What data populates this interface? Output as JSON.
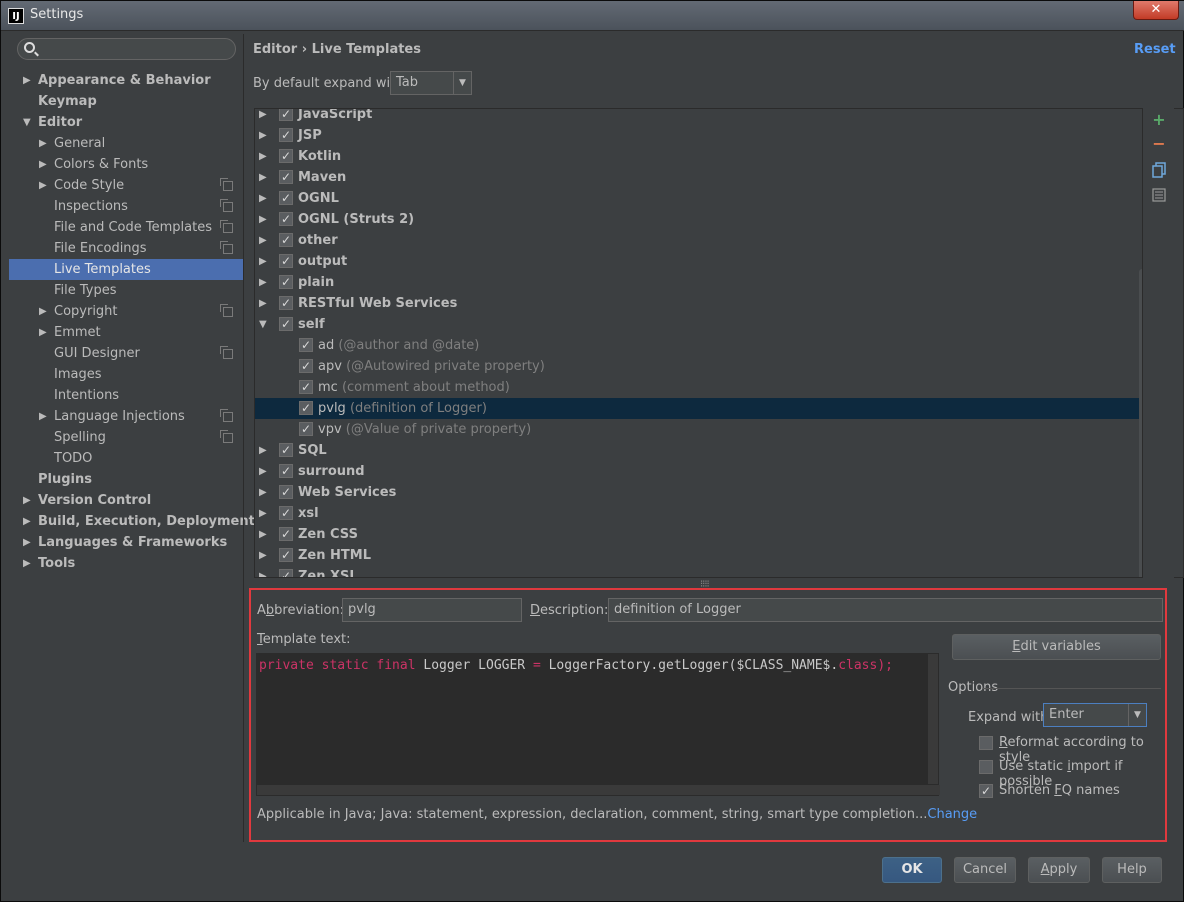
{
  "window": {
    "title": "Settings",
    "app_icon": "IJ",
    "close": "✕"
  },
  "search": {
    "value": ""
  },
  "tree": [
    {
      "label": "Appearance & Behavior",
      "level": 0,
      "bold": true,
      "arrow": "▶"
    },
    {
      "label": "Keymap",
      "level": 0,
      "bold": true,
      "arrow": ""
    },
    {
      "label": "Editor",
      "level": 0,
      "bold": true,
      "arrow": "▼"
    },
    {
      "label": "General",
      "level": 1,
      "arrow": "▶"
    },
    {
      "label": "Colors & Fonts",
      "level": 1,
      "arrow": "▶"
    },
    {
      "label": "Code Style",
      "level": 1,
      "arrow": "▶",
      "copy": true
    },
    {
      "label": "Inspections",
      "level": 1,
      "arrow": "",
      "copy": true
    },
    {
      "label": "File and Code Templates",
      "level": 1,
      "arrow": "",
      "copy": true
    },
    {
      "label": "File Encodings",
      "level": 1,
      "arrow": "",
      "copy": true
    },
    {
      "label": "Live Templates",
      "level": 1,
      "arrow": "",
      "selected": true
    },
    {
      "label": "File Types",
      "level": 1,
      "arrow": ""
    },
    {
      "label": "Copyright",
      "level": 1,
      "arrow": "▶",
      "copy": true
    },
    {
      "label": "Emmet",
      "level": 1,
      "arrow": "▶"
    },
    {
      "label": "GUI Designer",
      "level": 1,
      "arrow": "",
      "copy": true
    },
    {
      "label": "Images",
      "level": 1,
      "arrow": ""
    },
    {
      "label": "Intentions",
      "level": 1,
      "arrow": ""
    },
    {
      "label": "Language Injections",
      "level": 1,
      "arrow": "▶",
      "copy": true
    },
    {
      "label": "Spelling",
      "level": 1,
      "arrow": "",
      "copy": true
    },
    {
      "label": "TODO",
      "level": 1,
      "arrow": ""
    },
    {
      "label": "Plugins",
      "level": 0,
      "bold": true,
      "arrow": ""
    },
    {
      "label": "Version Control",
      "level": 0,
      "bold": true,
      "arrow": "▶"
    },
    {
      "label": "Build, Execution, Deployment",
      "level": 0,
      "bold": true,
      "arrow": "▶"
    },
    {
      "label": "Languages & Frameworks",
      "level": 0,
      "bold": true,
      "arrow": "▶"
    },
    {
      "label": "Tools",
      "level": 0,
      "bold": true,
      "arrow": "▶"
    }
  ],
  "header": {
    "crumb_parent": "Editor",
    "crumb_sep": "›",
    "crumb_current": "Live Templates",
    "reset": "Reset"
  },
  "expand_default": {
    "label": "By default expand with",
    "value": "Tab"
  },
  "groups": [
    {
      "type": "group",
      "name": "JavaScript",
      "expanded": false
    },
    {
      "type": "group",
      "name": "JSP",
      "expanded": false
    },
    {
      "type": "group",
      "name": "Kotlin",
      "expanded": false
    },
    {
      "type": "group",
      "name": "Maven",
      "expanded": false
    },
    {
      "type": "group",
      "name": "OGNL",
      "expanded": false
    },
    {
      "type": "group",
      "name": "OGNL (Struts 2)",
      "expanded": false
    },
    {
      "type": "group",
      "name": "other",
      "expanded": false
    },
    {
      "type": "group",
      "name": "output",
      "expanded": false
    },
    {
      "type": "group",
      "name": "plain",
      "expanded": false
    },
    {
      "type": "group",
      "name": "RESTful Web Services",
      "expanded": false
    },
    {
      "type": "group",
      "name": "self",
      "expanded": true
    },
    {
      "type": "item",
      "name": "ad",
      "desc": "(@author and @date)"
    },
    {
      "type": "item",
      "name": "apv",
      "desc": "(@Autowired private property)"
    },
    {
      "type": "item",
      "name": "mc",
      "desc": "(comment about method)"
    },
    {
      "type": "item",
      "name": "pvlg",
      "desc": "(definition of Logger)",
      "selected": true
    },
    {
      "type": "item",
      "name": "vpv",
      "desc": "(@Value of private property)"
    },
    {
      "type": "group",
      "name": "SQL",
      "expanded": false
    },
    {
      "type": "group",
      "name": "surround",
      "expanded": false
    },
    {
      "type": "group",
      "name": "Web Services",
      "expanded": false
    },
    {
      "type": "group",
      "name": "xsl",
      "expanded": false
    },
    {
      "type": "group",
      "name": "Zen CSS",
      "expanded": false
    },
    {
      "type": "group",
      "name": "Zen HTML",
      "expanded": false
    },
    {
      "type": "group",
      "name": "Zen XSL",
      "expanded": false
    }
  ],
  "tools": {
    "add": "+",
    "remove": "−"
  },
  "detail": {
    "abbr_label_pre": "A",
    "abbr_label_u": "b",
    "abbr_label_post": "breviation:",
    "abbr_value": "pvlg",
    "desc_label_u": "D",
    "desc_label_post": "escription:",
    "desc_value": "definition of Logger",
    "template_label_u": "T",
    "template_label_post": "emplate text:",
    "code_kw": "private static final",
    "code_plain1": " Logger LOGGER ",
    "code_eq": "=",
    "code_plain2": " LoggerFactory.getLogger($CLASS_NAME$.",
    "code_kw2": "class",
    "code_end": ");",
    "edit_vars_u": "E",
    "edit_vars_post": "dit variables",
    "options_label": "Options",
    "expand_with_label": "Expand with",
    "expand_with_value": "Enter",
    "reformat_u": "R",
    "reformat_post": "eformat according to style",
    "static_pre": "Use static ",
    "static_u": "i",
    "static_post": "mport if possible",
    "shorten_pre": "Shorten ",
    "shorten_u": "F",
    "shorten_post": "Q names",
    "applicable_text": "Applicable in Java; Java: statement, expression, declaration, comment, string, smart type completion...",
    "change_link": "Change"
  },
  "footer": {
    "ok": "OK",
    "cancel": "Cancel",
    "apply_u": "A",
    "apply_post": "pply",
    "help": "Help"
  },
  "colors": {
    "accent": "#589df6",
    "selection": "#4b6eaf",
    "highlight_box": "#e0393e"
  }
}
